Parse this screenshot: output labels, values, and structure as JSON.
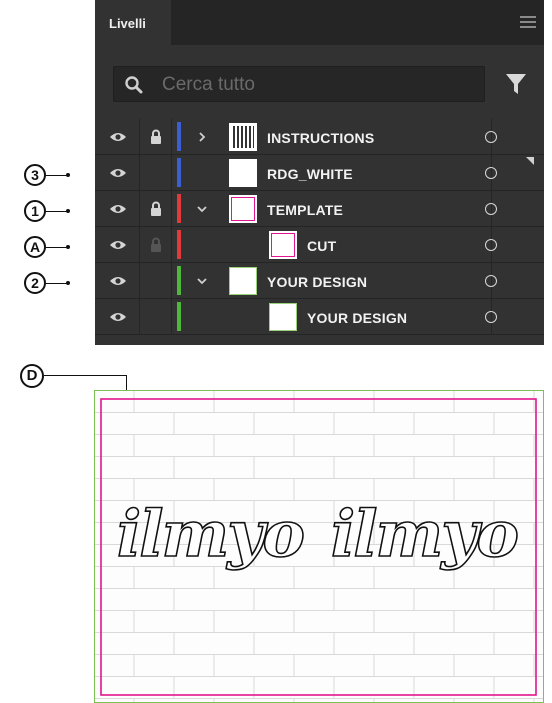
{
  "panel": {
    "tab_label": "Livelli",
    "menu_icon": "hamburger-menu-icon",
    "search": {
      "placeholder": "Cerca tutto",
      "icon": "search-icon"
    },
    "filter_icon": "filter-funnel-icon",
    "layers": [
      {
        "name": "INSTRUCTIONS",
        "visible": true,
        "locked": true,
        "color": "#3b5fd1",
        "expandable": true,
        "expanded": false,
        "indent": 0,
        "thumb": "pattern"
      },
      {
        "name": "RDG_WHITE",
        "visible": true,
        "locked": false,
        "color": "#3b5fd1",
        "expandable": false,
        "expanded": false,
        "indent": 0,
        "thumb": "white"
      },
      {
        "name": "TEMPLATE",
        "visible": true,
        "locked": true,
        "color": "#e03a3a",
        "expandable": true,
        "expanded": true,
        "indent": 0,
        "thumb": "magenta-frame"
      },
      {
        "name": "CUT",
        "visible": true,
        "locked": true,
        "lock_dim": true,
        "color": "#e03a3a",
        "expandable": false,
        "expanded": false,
        "indent": 1,
        "thumb": "magenta-frame"
      },
      {
        "name": "YOUR DESIGN",
        "visible": true,
        "locked": false,
        "color": "#4fb83a",
        "expandable": true,
        "expanded": true,
        "indent": 0,
        "thumb": "green-frame"
      },
      {
        "name": "YOUR DESIGN",
        "visible": true,
        "locked": false,
        "color": "#4fb83a",
        "expandable": false,
        "expanded": false,
        "indent": 1,
        "thumb": "green-frame"
      }
    ]
  },
  "callouts": {
    "three": "3",
    "one": "1",
    "a": "A",
    "two": "2",
    "d": "D"
  },
  "artboard": {
    "text_left": "ilmyo",
    "text_right": "ilmyo",
    "cut_color": "#e0158f",
    "bleed_color": "#7cc152"
  }
}
